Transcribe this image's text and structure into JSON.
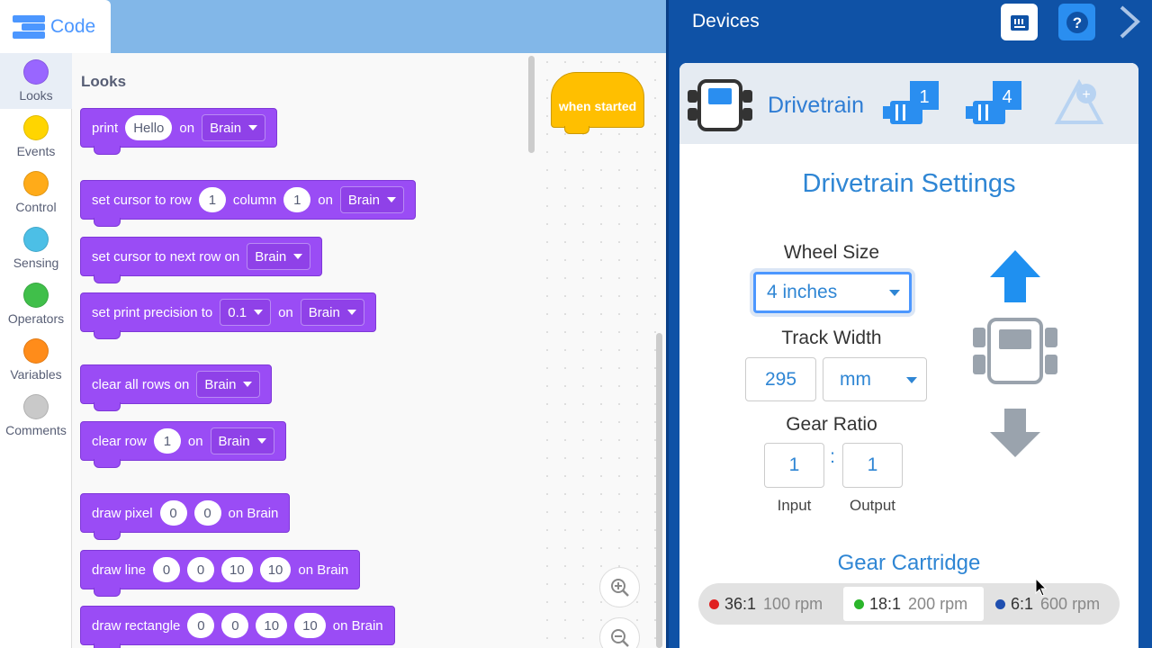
{
  "top_tab": {
    "label": "Code"
  },
  "categories": [
    {
      "label": "Looks",
      "color": "#9966ff"
    },
    {
      "label": "Events",
      "color": "#ffd500"
    },
    {
      "label": "Control",
      "color": "#ffab19"
    },
    {
      "label": "Sensing",
      "color": "#4cbfe6"
    },
    {
      "label": "Operators",
      "color": "#40bf4a"
    },
    {
      "label": "Variables",
      "color": "#ff8c1a"
    },
    {
      "label": "Comments",
      "color": "#c9c9c9"
    }
  ],
  "flyout": {
    "section_title": "Looks",
    "blocks": {
      "print": {
        "t1": "print",
        "v1": "Hello",
        "t2": "on",
        "dd": "Brain"
      },
      "set_cursor": {
        "t1": "set cursor to row",
        "v1": "1",
        "t2": "column",
        "v2": "1",
        "t3": "on",
        "dd": "Brain"
      },
      "next_row": {
        "t1": "set cursor to next row on",
        "dd": "Brain"
      },
      "precision": {
        "t1": "set print precision to",
        "dd1": "0.1",
        "t2": "on",
        "dd2": "Brain"
      },
      "clear_all": {
        "t1": "clear all rows on",
        "dd": "Brain"
      },
      "clear_row": {
        "t1": "clear row",
        "v1": "1",
        "t2": "on",
        "dd": "Brain"
      },
      "draw_pixel": {
        "t1": "draw pixel",
        "v1": "0",
        "v2": "0",
        "t2": "on Brain"
      },
      "draw_line": {
        "t1": "draw line",
        "v1": "0",
        "v2": "0",
        "v3": "10",
        "v4": "10",
        "t2": "on Brain"
      },
      "draw_rect": {
        "t1": "draw rectangle",
        "v1": "0",
        "v2": "0",
        "v3": "10",
        "v4": "10",
        "t2": "on Brain"
      }
    }
  },
  "workspace": {
    "hat_block": "when started"
  },
  "devices": {
    "title": "Devices",
    "tab_label": "Drivetrain",
    "motor_badges": [
      "1",
      "4"
    ],
    "settings_title": "Drivetrain Settings",
    "wheel_size": {
      "label": "Wheel Size",
      "value": "4 inches"
    },
    "track_width": {
      "label": "Track Width",
      "value": "295",
      "unit": "mm"
    },
    "gear_ratio": {
      "label": "Gear Ratio",
      "input": "1",
      "output": "1",
      "input_label": "Input",
      "output_label": "Output",
      "separator": ":"
    },
    "gear_cartridge": {
      "label": "Gear Cartridge",
      "options": [
        {
          "ratio": "36:1",
          "rpm": "100 rpm",
          "color": "#e02020"
        },
        {
          "ratio": "18:1",
          "rpm": "200 rpm",
          "color": "#2bb52b"
        },
        {
          "ratio": "6:1",
          "rpm": "600 rpm",
          "color": "#1f4fb0"
        }
      ],
      "selected": "18:1"
    }
  }
}
